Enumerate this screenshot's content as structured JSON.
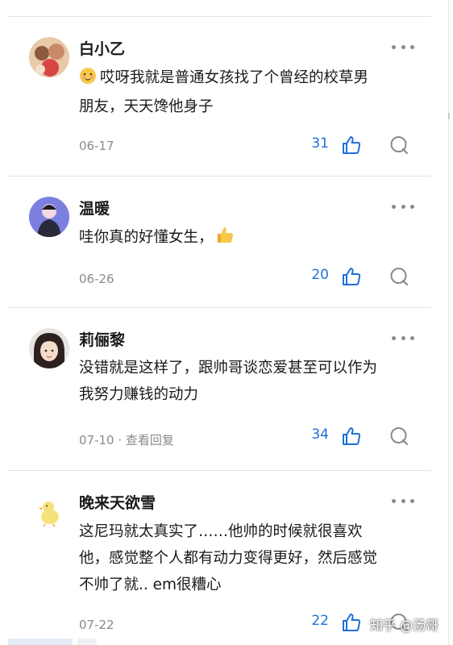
{
  "comments": [
    {
      "user": "白小乙",
      "lines": [
        "哎呀我就是普通女孩找了个曾经的校草男",
        "朋友，天天馋他身子"
      ],
      "emoji": "blush-face-emoji",
      "meta": "06-17",
      "likes": "31"
    },
    {
      "user": "温暖",
      "lines": [
        "哇你真的好懂女生，"
      ],
      "emoji": "thumbs-up-emoji",
      "meta": "06-26",
      "likes": "20"
    },
    {
      "user": "莉俪黎",
      "lines": [
        "没错就是这样了，跟帅哥谈恋爱甚至可以作为",
        "我努力赚钱的动力"
      ],
      "meta": "07-10 · 查看回复",
      "likes": "34"
    },
    {
      "user": "晚来天欲雪",
      "lines": [
        "这尼玛就太真实了……他帅的时候就很喜欢",
        "他，感觉整个人都有动力变得更好，然后感觉",
        "不帅了就.. em很糟心"
      ],
      "meta": "07-22",
      "likes": "22"
    }
  ],
  "watermark": "知乎 @汤哥",
  "colors": {
    "accent": "#1e6fd9",
    "muted": "#8a8a8a",
    "divider": "#e3e3e3"
  }
}
